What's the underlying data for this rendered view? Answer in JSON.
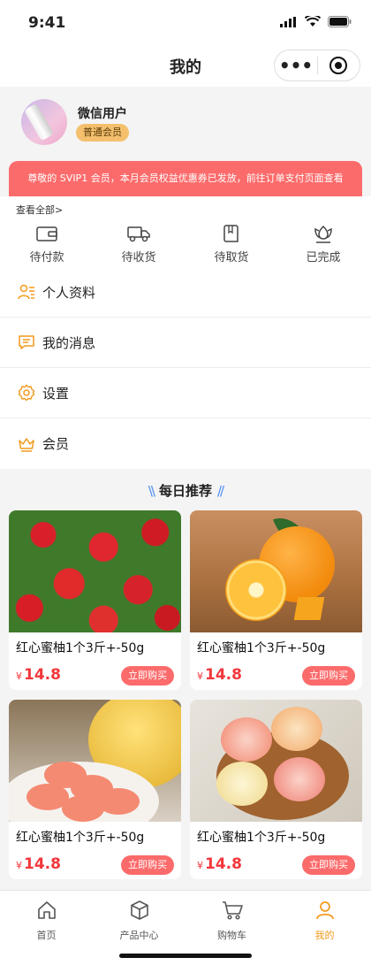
{
  "status_bar": {
    "time": "9:41"
  },
  "nav": {
    "title": "我的",
    "more_label": "•••"
  },
  "profile": {
    "name": "微信用户",
    "member_level": "普通会员"
  },
  "notice": {
    "text": "尊敬的 SVIP1 会员，本月会员权益优惠券已发放，前往订单支付页面查看"
  },
  "orders": {
    "view_all": "查看全部>",
    "items": [
      {
        "label": "待付款",
        "icon": "wallet-icon"
      },
      {
        "label": "待收货",
        "icon": "truck-icon"
      },
      {
        "label": "待取货",
        "icon": "package-icon"
      },
      {
        "label": "已完成",
        "icon": "tulip-icon"
      }
    ]
  },
  "menu": [
    {
      "label": "个人资料",
      "icon": "profile-icon"
    },
    {
      "label": "我的消息",
      "icon": "message-icon"
    },
    {
      "label": "设置",
      "icon": "gear-icon"
    },
    {
      "label": "会员",
      "icon": "crown-icon"
    }
  ],
  "recommend": {
    "title": "每日推荐",
    "products": [
      {
        "name": "红心蜜柚1个3斤+-50g",
        "currency": "¥",
        "price": "14.8",
        "buy_label": "立即购买",
        "image": "strawberries"
      },
      {
        "name": "红心蜜柚1个3斤+-50g",
        "currency": "¥",
        "price": "14.8",
        "buy_label": "立即购买",
        "image": "oranges"
      },
      {
        "name": "红心蜜柚1个3斤+-50g",
        "currency": "¥",
        "price": "14.8",
        "buy_label": "立即购买",
        "image": "grapefruit"
      },
      {
        "name": "红心蜜柚1个3斤+-50g",
        "currency": "¥",
        "price": "14.8",
        "buy_label": "立即购买",
        "image": "pomelo"
      }
    ]
  },
  "tabs": [
    {
      "label": "首页",
      "icon": "home-icon",
      "active": false
    },
    {
      "label": "产品中心",
      "icon": "box-icon",
      "active": false
    },
    {
      "label": "购物车",
      "icon": "cart-icon",
      "active": false
    },
    {
      "label": "我的",
      "icon": "user-icon",
      "active": true
    }
  ],
  "colors": {
    "accent": "#f29a1d",
    "notice_bg": "#fc6b6b",
    "price": "#f2373b",
    "badge": "#f4c06e"
  }
}
